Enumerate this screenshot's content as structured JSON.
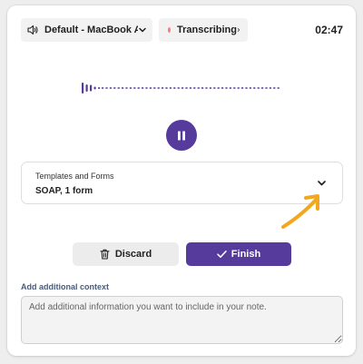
{
  "header": {
    "device_label": "Default - MacBook A...",
    "status_label": "Transcribing",
    "timer": "02:47"
  },
  "templates": {
    "caption": "Templates and Forms",
    "value": "SOAP, 1 form"
  },
  "actions": {
    "discard_label": "Discard",
    "finish_label": "Finish"
  },
  "context": {
    "label": "Add additional context",
    "placeholder": "Add additional information you want to include in your note."
  },
  "icons": {
    "speaker": "speaker-icon",
    "status_dot": "recording-dot-icon",
    "pause": "pause-icon",
    "trash": "trash-icon",
    "check": "check-icon",
    "chevron": "chevron-down-icon",
    "arrow": "pointer-arrow-icon"
  },
  "colors": {
    "accent": "#563a9c",
    "recording_dot": "#f47b7b",
    "annotation_arrow": "#f2a81d",
    "context_label": "#4a5b78"
  }
}
